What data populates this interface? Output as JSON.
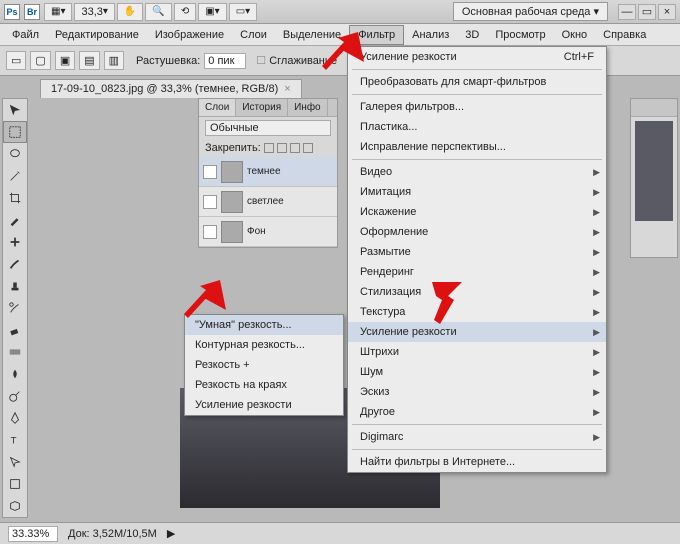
{
  "title": {
    "ps_badge": "Ps",
    "br_badge": "Br",
    "zoom_dropdown": "33,3",
    "workspace": "Основная рабочая среда"
  },
  "menubar": [
    "Файл",
    "Редактирование",
    "Изображение",
    "Слои",
    "Выделение",
    "Фильтр",
    "Анализ",
    "3D",
    "Просмотр",
    "Окно",
    "Справка"
  ],
  "optionsbar": {
    "feather_label": "Растушевка:",
    "feather_value": "0 пик",
    "antialias_label": "Сглаживание"
  },
  "doc_tab": {
    "label": "17-09-10_0823.jpg @ 33,3% (темнее, RGB/8)",
    "close": "×"
  },
  "layers_panel": {
    "tabs": [
      "Слои",
      "История",
      "Инфо"
    ],
    "blend_mode": "Обычные",
    "lock_label": "Закрепить:",
    "layers": [
      {
        "name": "темнее"
      },
      {
        "name": "светлее"
      },
      {
        "name": "Фон"
      }
    ]
  },
  "sharpen_submenu": [
    "\"Умная\" резкость...",
    "Контурная резкость...",
    "Резкость +",
    "Резкость на краях",
    "Усиление резкости"
  ],
  "filter_menu": {
    "top": {
      "label": "Усиление резкости",
      "shortcut": "Ctrl+F"
    },
    "convert": "Преобразовать для смарт-фильтров",
    "gallery": "Галерея фильтров...",
    "liquify": "Пластика...",
    "vanishing": "Исправление перспективы...",
    "groups": [
      "Видео",
      "Имитация",
      "Искажение",
      "Оформление",
      "Размытие",
      "Рендеринг",
      "Стилизация",
      "Текстура",
      "Усиление резкости",
      "Штрихи",
      "Шум",
      "Эскиз",
      "Другое"
    ],
    "digimarc": "Digimarc",
    "browse": "Найти фильтры в Интернете..."
  },
  "statusbar": {
    "zoom": "33.33%",
    "doc_label": "Док:",
    "doc_value": "3,52M/10,5M"
  }
}
